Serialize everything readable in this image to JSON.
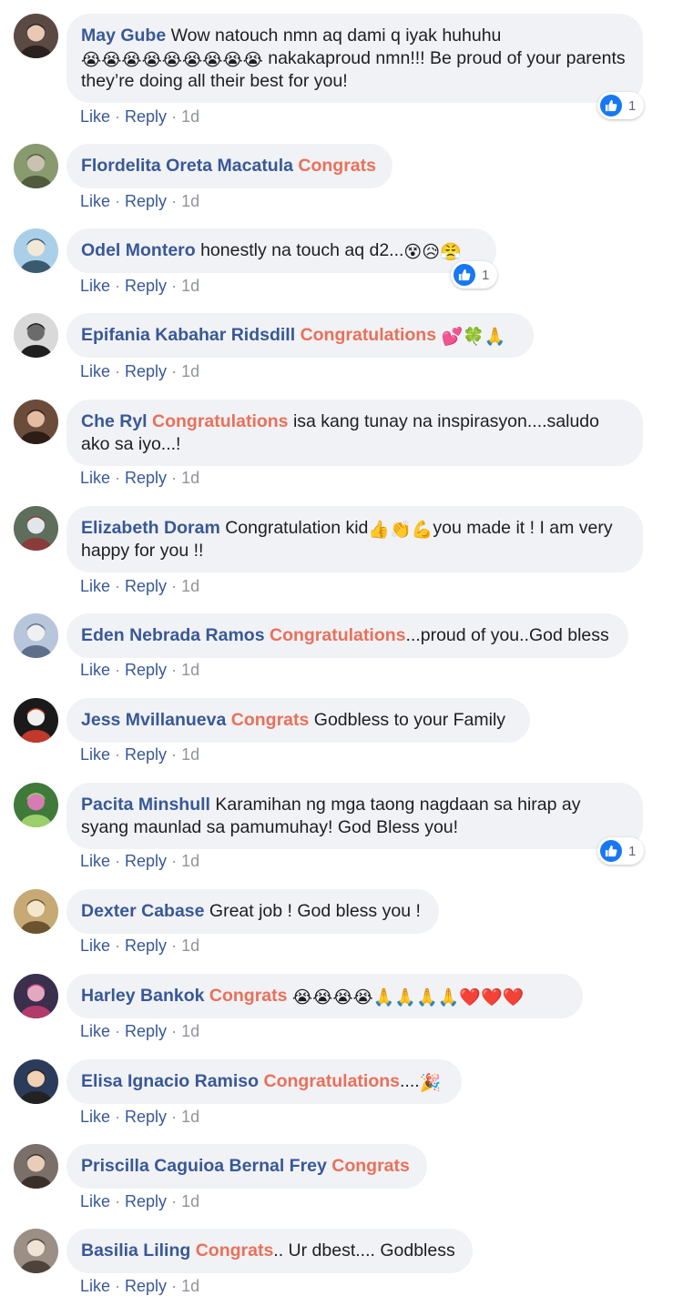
{
  "colors": {
    "author": "#385898",
    "highlight": "#e9705a",
    "bubble": "#f1f2f5",
    "meta": "#90949c",
    "like_badge": "#1877f2"
  },
  "actions": {
    "like": "Like",
    "reply": "Reply",
    "separator": "·"
  },
  "comments": [
    {
      "author": "May Gube",
      "segments": [
        {
          "t": "text",
          "v": " Wow natouch nmn aq dami q iyak huhuhu"
        },
        {
          "t": "emoji",
          "v": "😭😭😭😭😭😭😭😭😭"
        },
        {
          "t": "text",
          "v": " nakakaproud nmn!!! Be proud of your parents they’re doing all their best for you!"
        }
      ],
      "time": "1d",
      "reactions": "1",
      "avatar_icon": "woman-portrait-avatar"
    },
    {
      "author": "Flordelita Oreta Macatula",
      "segments": [
        {
          "t": "text",
          "v": " "
        },
        {
          "t": "tag",
          "v": "Congrats"
        }
      ],
      "time": "1d",
      "avatar_icon": "outdoor-photo-avatar"
    },
    {
      "author": "Odel Montero",
      "segments": [
        {
          "t": "text",
          "v": " honestly na touch aq d2..."
        },
        {
          "t": "emoji",
          "v": "😵😥😤"
        }
      ],
      "time": "1d",
      "reactions": "1",
      "avatar_icon": "cartoon-couple-avatar"
    },
    {
      "author": "Epifania Kabahar Ridsdill",
      "segments": [
        {
          "t": "text",
          "v": " "
        },
        {
          "t": "tag",
          "v": "Congratulations"
        },
        {
          "t": "text",
          "v": " "
        },
        {
          "t": "emoji",
          "v": "💕🍀🙏"
        }
      ],
      "time": "1d",
      "avatar_icon": "vintage-portrait-avatar"
    },
    {
      "author": "Che Ryl",
      "segments": [
        {
          "t": "text",
          "v": " "
        },
        {
          "t": "tag",
          "v": "Congratulations"
        },
        {
          "t": "text",
          "v": " isa kang tunay na inspirasyon....saludo ako sa iyo...!"
        }
      ],
      "time": "1d",
      "avatar_icon": "woman-portrait-avatar"
    },
    {
      "author": "Elizabeth Doram",
      "segments": [
        {
          "t": "text",
          "v": " Congratulation kid"
        },
        {
          "t": "emoji",
          "v": "👍👏💪"
        },
        {
          "t": "text",
          "v": "you made it ! I am very happy for you !!"
        }
      ],
      "time": "1d",
      "avatar_icon": "group-photo-avatar"
    },
    {
      "author": "Eden Nebrada Ramos",
      "segments": [
        {
          "t": "text",
          "v": " "
        },
        {
          "t": "tag",
          "v": "Congratulations"
        },
        {
          "t": "text",
          "v": "...proud of you..God bless"
        }
      ],
      "time": "1d",
      "avatar_icon": "capitol-building-avatar"
    },
    {
      "author": "Jess Mvillanueva",
      "segments": [
        {
          "t": "text",
          "v": " "
        },
        {
          "t": "tag",
          "v": "Congrats"
        },
        {
          "t": "text",
          "v": " Godbless to your Family"
        }
      ],
      "time": "1d",
      "avatar_icon": "collage-avatar"
    },
    {
      "author": "Pacita Minshull",
      "segments": [
        {
          "t": "text",
          "v": " Karamihan ng mga taong nagdaan sa hirap ay syang maunlad sa pamumuhay! God Bless you!"
        }
      ],
      "time": "1d",
      "reactions": "1",
      "avatar_icon": "flowers-avatar"
    },
    {
      "author": "Dexter Cabase",
      "segments": [
        {
          "t": "text",
          "v": " Great job ! God bless you !"
        }
      ],
      "time": "1d",
      "avatar_icon": "church-interior-avatar"
    },
    {
      "author": "Harley Bankok",
      "segments": [
        {
          "t": "text",
          "v": " "
        },
        {
          "t": "tag",
          "v": "Congrats"
        },
        {
          "t": "text",
          "v": " "
        },
        {
          "t": "emoji",
          "v": "😭😭😭😭🙏🙏🙏🙏❤️❤️❤️"
        }
      ],
      "time": "1d",
      "avatar_icon": "woman-portrait-avatar"
    },
    {
      "author": "Elisa Ignacio Ramiso",
      "segments": [
        {
          "t": "text",
          "v": " "
        },
        {
          "t": "tag",
          "v": "Congratulations"
        },
        {
          "t": "text",
          "v": "...."
        },
        {
          "t": "emoji",
          "v": "🎉"
        }
      ],
      "time": "1d",
      "avatar_icon": "character-photo-avatar"
    },
    {
      "author": "Priscilla Caguioa Bernal Frey",
      "segments": [
        {
          "t": "text",
          "v": " "
        },
        {
          "t": "tag",
          "v": "Congrats"
        }
      ],
      "time": "1d",
      "avatar_icon": "couple-photo-avatar"
    },
    {
      "author": "Basilia Liling",
      "segments": [
        {
          "t": "text",
          "v": " "
        },
        {
          "t": "tag",
          "v": "Congrats"
        },
        {
          "t": "text",
          "v": ".. Ur dbest.... Godbless"
        }
      ],
      "time": "1d",
      "avatar_icon": "elderly-portrait-avatar"
    }
  ]
}
